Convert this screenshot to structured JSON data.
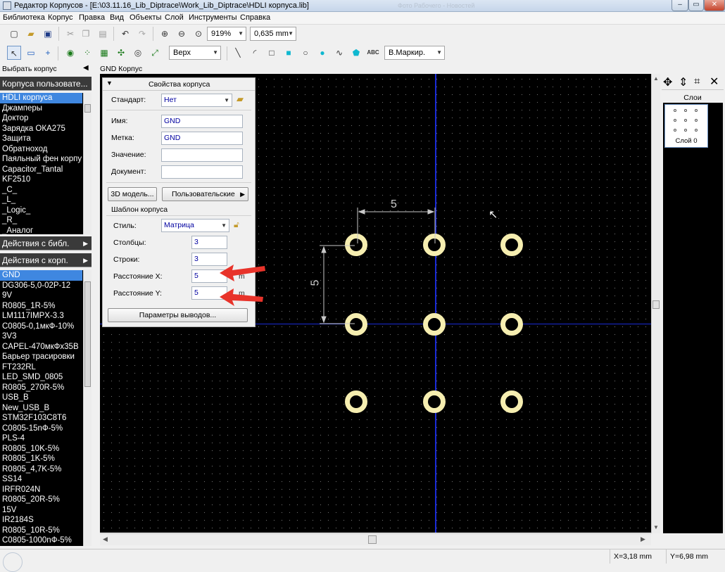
{
  "window": {
    "title": "Редактор Корпусов - [E:\\03.11.16_Lib_Diptrace\\Work_Lib_Diptrace\\HDLI корпуса.lib]",
    "faint_title": "Фото Рабочего - Новостей"
  },
  "menu": [
    "Библиотека",
    "Корпус",
    "Правка",
    "Вид",
    "Объекты",
    "Слой",
    "Инструменты",
    "Справка"
  ],
  "toolbar": {
    "zoom": "919%",
    "grid": "0,635 mm",
    "layer": "Верх",
    "text_style": "В.Маркир."
  },
  "left_panel": {
    "title": "Выбрать корпус",
    "category_header": "Корпуса пользовате...",
    "categories": [
      "HDLI корпуса",
      "Джамперы",
      "Доктор",
      "Зарядка ОКА275",
      "Защита",
      "Обратноход",
      "Паяльный фен корпу",
      "Capacitor_Tantal",
      "KF2510",
      "_C_",
      "_L_",
      "_Logic_",
      "_R_",
      "_Аналог"
    ],
    "lib_actions": "Действия с библ.",
    "comp_actions": "Действия с корп.",
    "components": [
      "GND",
      "DG306-5,0-02P-12",
      "9V",
      "R0805_1R-5%",
      "LM1117IMPX-3.3",
      "C0805-0,1мкФ-10%",
      "3V3",
      "CAPEL-470мкФх35В",
      "Барьер трасировки",
      "FT232RL",
      "LED_SMD_0805",
      "R0805_270R-5%",
      "USB_B",
      "New_USB_B",
      "STM32F103C8T6",
      "C0805-15nФ-5%",
      "PLS-4",
      "R0805_10K-5%",
      "R0805_1K-5%",
      "R0805_4,7K-5%",
      "SS14",
      "IRFR024N",
      "R0805_20R-5%",
      "15V",
      "IR2184S",
      "R0805_10R-5%",
      "C0805-1000nФ-5%"
    ]
  },
  "canvas": {
    "title": "GND Корпус",
    "dim_horizontal": "5",
    "dim_vertical": "5"
  },
  "properties": {
    "header": "Свойства корпуса",
    "standard_label": "Стандарт:",
    "standard_value": "Нет",
    "name_label": "Имя:",
    "name_value": "GND",
    "mark_label": "Метка:",
    "mark_value": "GND",
    "value_label": "Значение:",
    "value_value": "",
    "doc_label": "Документ:",
    "doc_value": "",
    "model3d_button": "3D модель...",
    "custom_button": "Пользовательские",
    "template_group": "Шаблон корпуса",
    "style_label": "Стиль:",
    "style_value": "Матрица",
    "columns_label": "Столбцы:",
    "columns_value": "3",
    "rows_label": "Строки:",
    "rows_value": "3",
    "spacing_x_label": "Расстояние X:",
    "spacing_x_value": "5",
    "spacing_y_label": "Расстояние Y:",
    "spacing_y_value": "5",
    "unit_x": "m",
    "unit_y": "m",
    "pins_button": "Параметры выводов..."
  },
  "right_panel": {
    "title": "Слои",
    "layer_name": "Слой 0"
  },
  "status": {
    "x": "X=3,18 mm",
    "y": "Y=6,98 mm"
  },
  "colors": {
    "canvas_bg": "#000000",
    "pad": "#f6eeb0",
    "origin_axis": "#1a2bd6",
    "annotation_arrow": "#e8332a",
    "selection": "#3f87e0"
  }
}
